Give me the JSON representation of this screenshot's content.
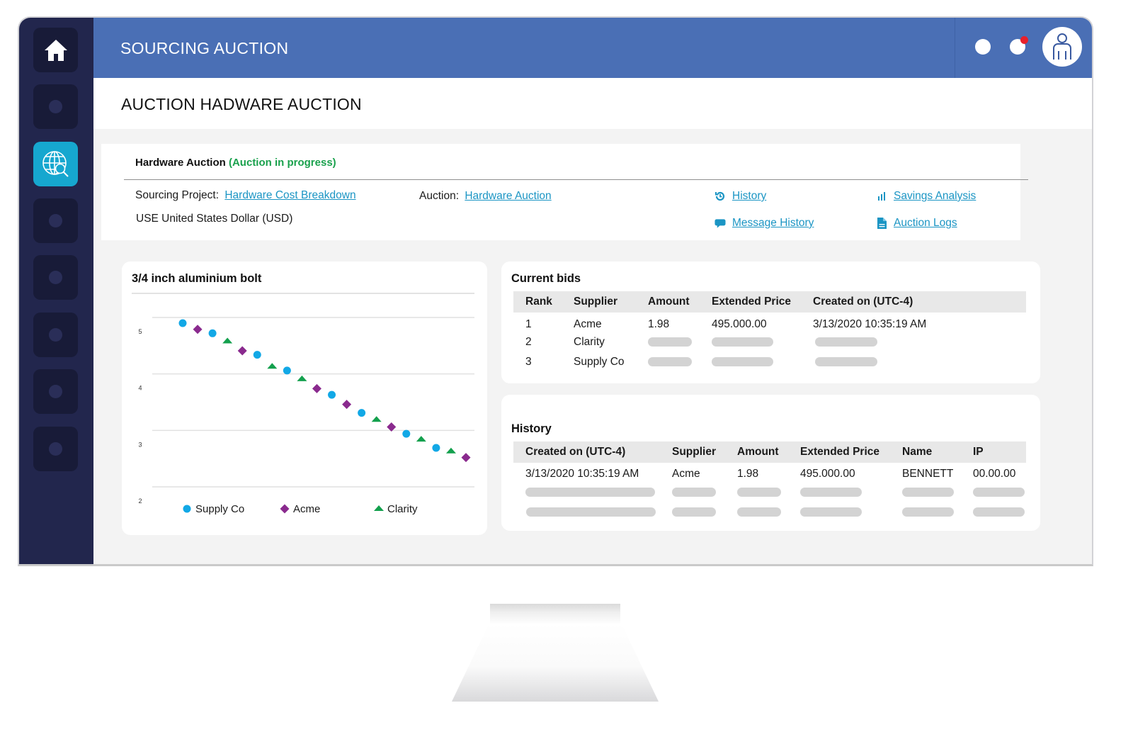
{
  "app": {
    "title": "SOURCING AUCTION",
    "page_title": "AUCTION HADWARE AUCTION"
  },
  "colors": {
    "topbar": "#4a6fb5",
    "sidebar": "#22264d",
    "sidebar_active": "#16a7cf",
    "link": "#1b95c4",
    "status_green": "#1aa14d",
    "notification_badge": "#e8202a"
  },
  "sidebar": {
    "items": [
      {
        "icon": "home-icon",
        "active": false
      },
      {
        "icon": "placeholder-icon",
        "active": false
      },
      {
        "icon": "globe-search-icon",
        "active": true
      },
      {
        "icon": "placeholder-icon",
        "active": false
      },
      {
        "icon": "placeholder-icon",
        "active": false
      },
      {
        "icon": "placeholder-icon",
        "active": false
      },
      {
        "icon": "placeholder-icon",
        "active": false
      },
      {
        "icon": "placeholder-icon",
        "active": false
      }
    ]
  },
  "header_actions": [
    {
      "icon": "status-dot-icon"
    },
    {
      "icon": "notification-icon",
      "badge": true
    },
    {
      "icon": "user-avatar-icon"
    }
  ],
  "auction": {
    "name": "Hardware Auction",
    "status": "(Auction in progress)",
    "sourcing_project_label": "Sourcing Project:",
    "sourcing_project_link": "Hardware Cost Breakdown",
    "auction_label": "Auction:",
    "auction_link": "Hardware Auction",
    "currency": "USE United States Dollar (USD)",
    "links": [
      {
        "label": "History",
        "icon": "history-icon"
      },
      {
        "label": "Savings Analysis",
        "icon": "bar-chart-icon"
      },
      {
        "label": "Message History",
        "icon": "chat-bubble-icon"
      },
      {
        "label": "Auction Logs",
        "icon": "document-icon"
      }
    ]
  },
  "chart_data": {
    "type": "scatter",
    "title": "3/4 inch aluminium bolt",
    "xlabel": "",
    "ylabel": "",
    "ylim": [
      2,
      5
    ],
    "yticks": [
      "5",
      "4",
      "3",
      "2"
    ],
    "grid": true,
    "legend_position": "bottom",
    "x": [
      1,
      2,
      3,
      4,
      5,
      6,
      7,
      8,
      9,
      10,
      11,
      12,
      13,
      14,
      15,
      16,
      17,
      18,
      19,
      20
    ],
    "series": [
      {
        "name": "Supply Co",
        "marker": "circle",
        "color": "#12a8e6",
        "points": [
          [
            1,
            4.9
          ],
          [
            3,
            4.72
          ],
          [
            6,
            4.34
          ],
          [
            8,
            4.06
          ],
          [
            11,
            3.63
          ],
          [
            13,
            3.31
          ],
          [
            16,
            2.94
          ],
          [
            18,
            2.69
          ]
        ]
      },
      {
        "name": "Acme",
        "marker": "diamond",
        "color": "#8a2a8e",
        "points": [
          [
            2,
            4.79
          ],
          [
            5,
            4.41
          ],
          [
            10,
            3.74
          ],
          [
            12,
            3.46
          ],
          [
            15,
            3.06
          ],
          [
            20,
            2.52
          ]
        ]
      },
      {
        "name": "Clarity",
        "marker": "triangle",
        "color": "#13a04d",
        "points": [
          [
            4,
            4.58
          ],
          [
            7,
            4.13
          ],
          [
            9,
            3.91
          ],
          [
            14,
            3.19
          ],
          [
            17,
            2.84
          ],
          [
            19,
            2.63
          ]
        ]
      }
    ]
  },
  "current_bids": {
    "title": "Current bids",
    "columns": [
      "Rank",
      "Supplier",
      "Amount",
      "Extended Price",
      "Created on (UTC-4)"
    ],
    "rows": [
      {
        "rank": "1",
        "supplier": "Acme",
        "amount": "1.98",
        "extended_price": "495.000.00",
        "created_on": "3/13/2020  10:35:19 AM"
      },
      {
        "rank": "2",
        "supplier": "Clarity",
        "amount": null,
        "extended_price": null,
        "created_on": null
      },
      {
        "rank": "3",
        "supplier": "Supply Co",
        "amount": null,
        "extended_price": null,
        "created_on": null
      }
    ]
  },
  "history": {
    "title": "History",
    "columns": [
      "Created on (UTC-4)",
      "Supplier",
      "Amount",
      "Extended Price",
      "Name",
      "IP"
    ],
    "rows": [
      {
        "created_on": "3/13/2020  10:35:19 AM",
        "supplier": "Acme",
        "amount": "1.98",
        "extended_price": "495.000.00",
        "name": "BENNETT",
        "ip": "00.00.00"
      },
      {
        "created_on": null,
        "supplier": null,
        "amount": null,
        "extended_price": null,
        "name": null,
        "ip": null
      },
      {
        "created_on": null,
        "supplier": null,
        "amount": null,
        "extended_price": null,
        "name": null,
        "ip": null
      }
    ]
  }
}
